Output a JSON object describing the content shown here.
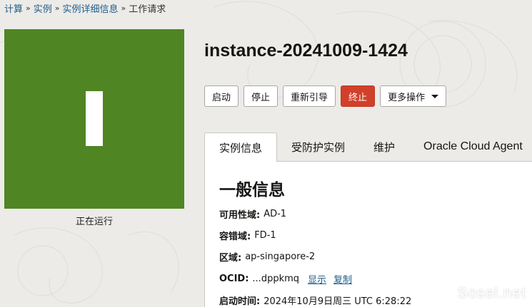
{
  "breadcrumb": {
    "items": [
      "计算",
      "实例",
      "实例详细信息"
    ],
    "current": "工作请求",
    "separator": "»"
  },
  "instance": {
    "name": "instance-20241009-1424",
    "status": "正在运行",
    "status_color": "#4f8523",
    "status_glyph": "I"
  },
  "actions": {
    "start": "启动",
    "stop": "停止",
    "reboot": "重新引导",
    "terminate": "终止",
    "more": "更多操作"
  },
  "tabs": [
    "实例信息",
    "受防护实例",
    "维护",
    "Oracle Cloud Agent"
  ],
  "active_tab": "实例信息",
  "general_info": {
    "title": "一般信息",
    "availability_domain": {
      "label": "可用性域:",
      "value": "AD-1"
    },
    "fault_domain": {
      "label": "容错域:",
      "value": "FD-1"
    },
    "region": {
      "label": "区域:",
      "value": "ap-singapore-2"
    },
    "ocid": {
      "label": "OCID:",
      "value": "...dppkmq",
      "show": "显示",
      "copy": "复制"
    },
    "launch_time": {
      "label": "启动时间:",
      "value": "2024年10月9日周三 UTC 6:28:22"
    }
  },
  "watermark": "Sosel.net",
  "colors": {
    "accent_link": "#1f5c8a",
    "danger": "#d1402a",
    "background": "#ecebe8"
  }
}
